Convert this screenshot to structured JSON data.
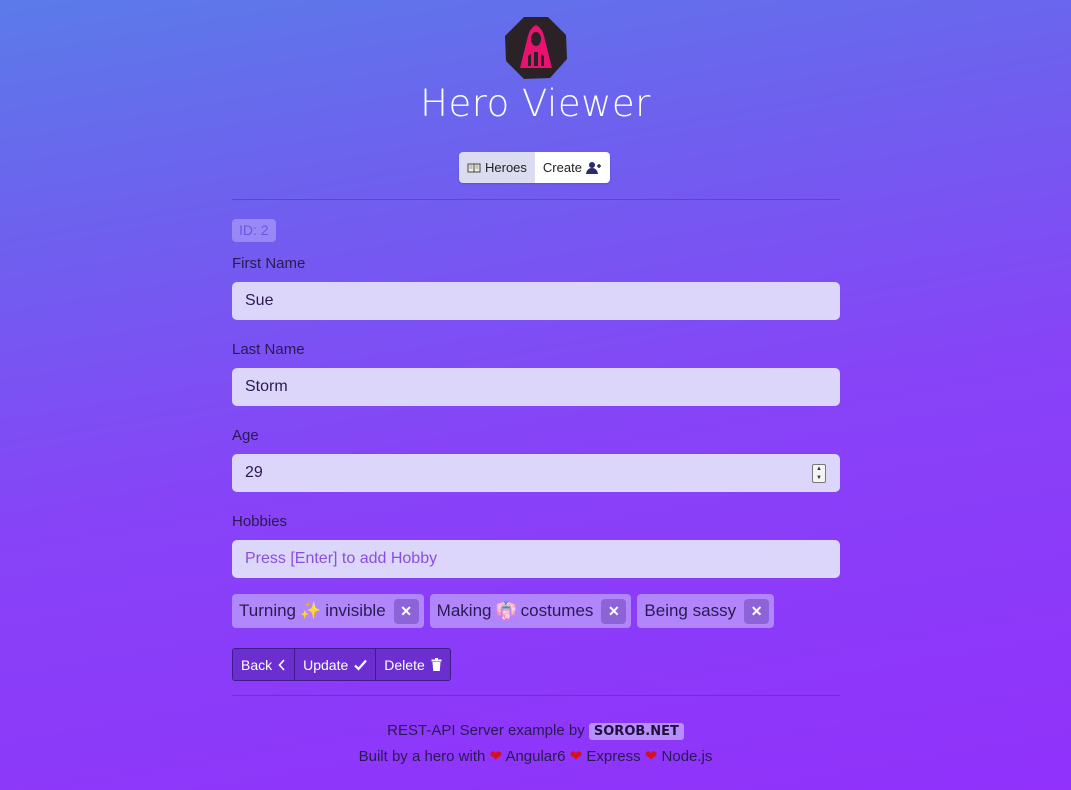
{
  "app": {
    "title": "Hero Viewer"
  },
  "nav": {
    "heroes_label": "Heroes",
    "create_label": "Create"
  },
  "form": {
    "id_badge": "ID: 2",
    "first_name": {
      "label": "First Name",
      "value": "Sue"
    },
    "last_name": {
      "label": "Last Name",
      "value": "Storm"
    },
    "age": {
      "label": "Age",
      "value": "29"
    },
    "hobbies": {
      "label": "Hobbies",
      "placeholder": "Press [Enter] to add Hobby",
      "items": [
        {
          "before": "Turning ",
          "emoji": "✨",
          "after": "invisible"
        },
        {
          "before": "Making ",
          "emoji": "👘",
          "after": "costumes"
        },
        {
          "before": "Being sassy",
          "emoji": "",
          "after": ""
        }
      ]
    }
  },
  "actions": {
    "back_label": "Back",
    "update_label": "Update",
    "delete_label": "Delete"
  },
  "footer": {
    "line1_text": "REST-API Server example by",
    "brand": "SOROB.NET",
    "line2_prefix": "Built by a hero with",
    "tech": [
      "Angular6",
      "Express",
      "Node.js"
    ]
  },
  "colors": {
    "gradient_top": "#5b7be9",
    "gradient_bottom": "#9131fb",
    "input_bg": "#ddd6fb",
    "button_bg": "#6b2fcf",
    "logo_pink": "#e8136e",
    "logo_dark": "#2b2228"
  }
}
